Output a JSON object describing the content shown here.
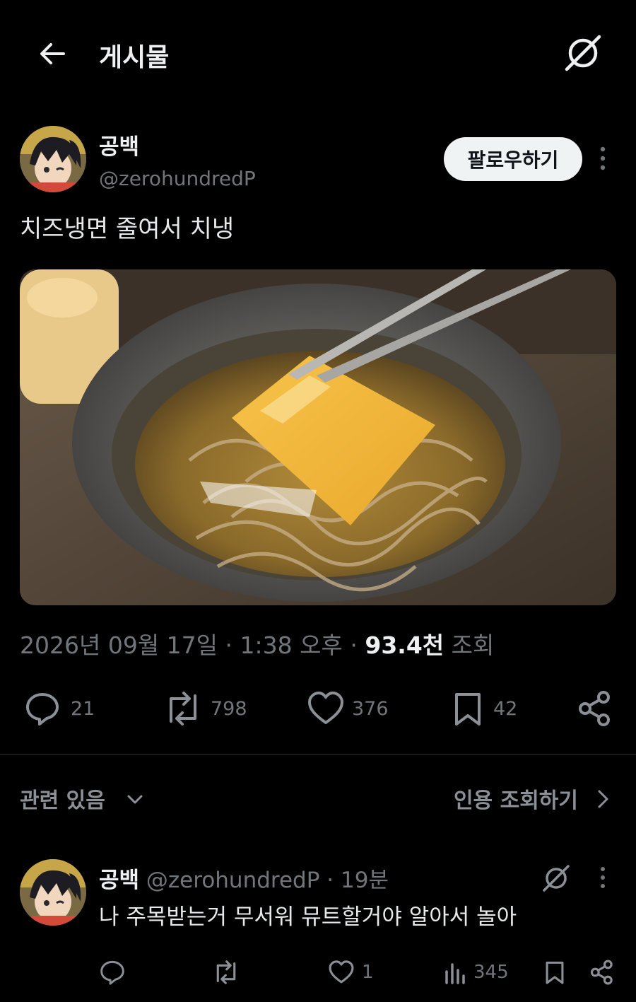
{
  "header": {
    "title": "게시물",
    "back_icon": "arrow-left-icon",
    "grok_icon": "grok-icon"
  },
  "post": {
    "author_name": "공백",
    "author_handle": "@zerohundredP",
    "follow_label": "팔로우하기",
    "text": "치즈냉면 줄여서 치냉",
    "image_alt": "cold noodles with cheese slice",
    "date": "2026년 09월 17일",
    "time": "1:38 오후",
    "separator": "·",
    "views_count": "93.4천",
    "views_label": "조회",
    "stats": {
      "replies": "21",
      "reposts": "798",
      "likes": "376",
      "bookmarks": "42"
    }
  },
  "related": {
    "label": "관련 있음",
    "quotes_link": "인용 조회하기"
  },
  "reply": {
    "author_name": "공백",
    "author_handle": "@zerohundredP",
    "separator": "·",
    "time": "19분",
    "text": "나 주목받는거 무서워 뮤트할거야 알아서 놀아",
    "stats": {
      "likes": "1",
      "views": "345"
    }
  },
  "colors": {
    "background": "#000000",
    "text": "#e7e9ea",
    "muted": "#71767b",
    "follow_bg": "#eff3f4"
  }
}
